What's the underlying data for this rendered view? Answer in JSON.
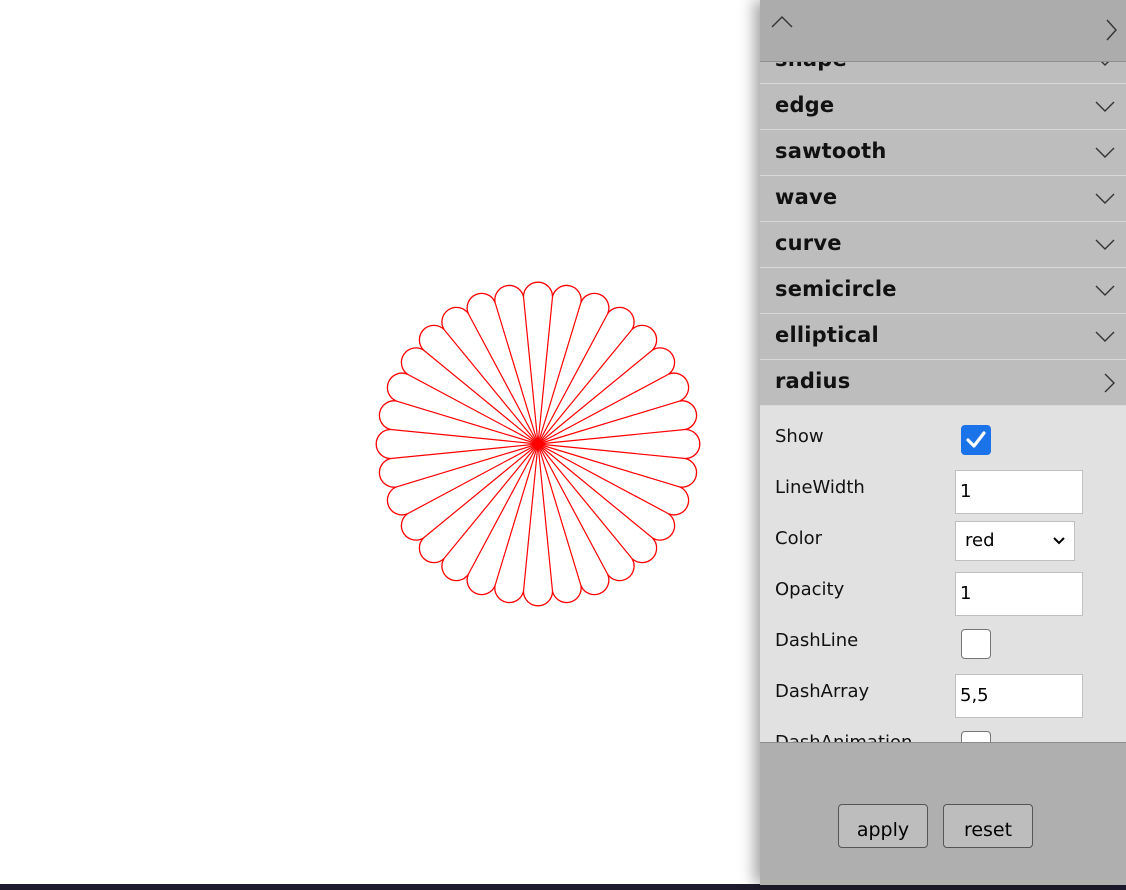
{
  "figure": {
    "petal_count": 32,
    "stroke_color": "#ff0000",
    "petal_shape": "semicircle"
  },
  "panel": {
    "sections": [
      {
        "label": "shape",
        "expanded": false
      },
      {
        "label": "edge",
        "expanded": false
      },
      {
        "label": "sawtooth",
        "expanded": false
      },
      {
        "label": "wave",
        "expanded": false
      },
      {
        "label": "curve",
        "expanded": false
      },
      {
        "label": "semicircle",
        "expanded": false
      },
      {
        "label": "elliptical",
        "expanded": false
      },
      {
        "label": "radius",
        "expanded": true
      }
    ],
    "radius": {
      "show_label": "Show",
      "show_checked": true,
      "linewidth_label": "LineWidth",
      "linewidth_value": "1",
      "color_label": "Color",
      "color_value": "red",
      "opacity_label": "Opacity",
      "opacity_value": "1",
      "dashline_label": "DashLine",
      "dashline_checked": false,
      "dasharray_label": "DashArray",
      "dasharray_value": "5,5",
      "dashanimation_label": "DashAnimation",
      "dashanimation_checked": false
    },
    "buttons": {
      "apply": "apply",
      "reset": "reset"
    }
  },
  "colors": {
    "panel_bg": "#afafaf",
    "header_bg": "#bdbdbd",
    "body_bg": "#e1e1e1",
    "checkbox_checked": "#1a73e8"
  }
}
